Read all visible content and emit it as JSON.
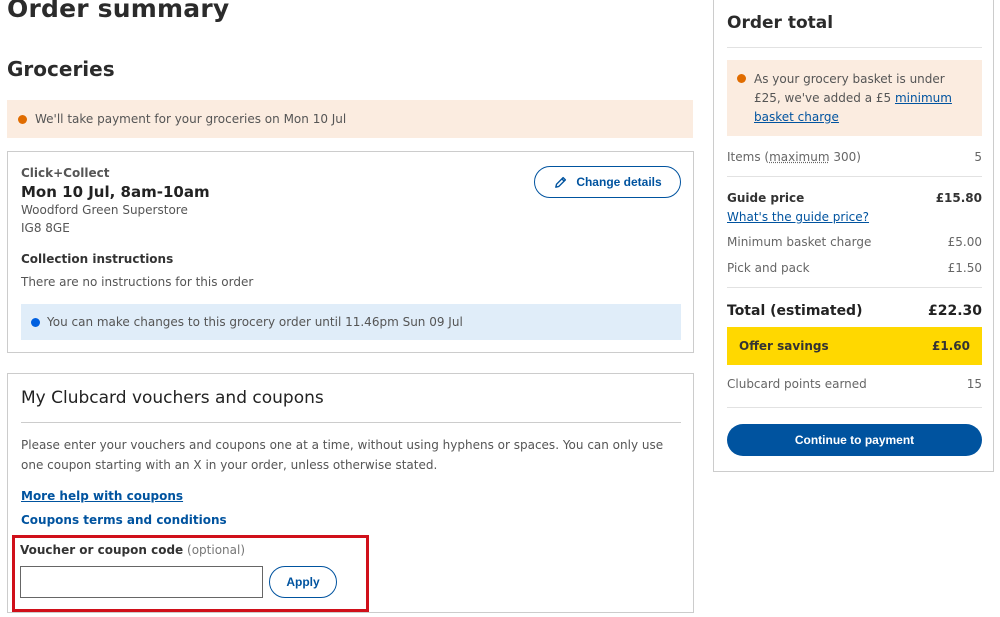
{
  "page": {
    "title": "Order summary",
    "section_title": "Groceries"
  },
  "payment_notice": {
    "icon": "orange-dot-icon",
    "text": "We'll take payment for your groceries on Mon 10 Jul"
  },
  "collection": {
    "type": "Click+Collect",
    "slot": "Mon 10 Jul, 8am-10am",
    "store": "Woodford Green Superstore",
    "postcode": "IG8 8GE",
    "change_button": {
      "icon": "pencil-icon",
      "label": "Change details"
    },
    "instructions_title": "Collection instructions",
    "instructions_text": "There are no instructions for this order",
    "changes_notice": {
      "icon": "blue-dot-icon",
      "text": "You can make changes to this grocery order until 11.46pm Sun 09 Jul"
    }
  },
  "coupons": {
    "heading": "My Clubcard vouchers and coupons",
    "description": "Please enter your vouchers and coupons one at a time, without using hyphens or spaces. You can only use one coupon starting with an X in your order, unless otherwise stated.",
    "help_link": "More help with coupons",
    "terms_link": "Coupons terms and conditions",
    "field_label": "Voucher or coupon code",
    "field_optional": "(optional)",
    "field_value": "",
    "field_placeholder": "",
    "apply_label": "Apply"
  },
  "order_total": {
    "title": "Order total",
    "min_notice": {
      "icon": "orange-dot-icon",
      "text_before": "As your grocery basket is under £25, we've added a £5 ",
      "link": "minimum basket charge"
    },
    "items": {
      "label_prefix": "Items (",
      "label_abbr": "maximum",
      "label_suffix": " 300)",
      "value": "5"
    },
    "guide_price": {
      "label": "Guide price",
      "value": "£15.80",
      "link": "What's the guide price?"
    },
    "min_basket_charge": {
      "label": "Minimum basket charge",
      "value": "£5.00"
    },
    "pick_and_pack": {
      "label": "Pick and pack",
      "value": "£1.50"
    },
    "total": {
      "label": "Total (estimated)",
      "value": "£22.30"
    },
    "savings": {
      "label": "Offer savings",
      "value": "£1.60"
    },
    "clubcard_points": {
      "label": "Clubcard points earned",
      "value": "15"
    },
    "continue_label": "Continue to payment"
  },
  "colors": {
    "brand_blue": "#00539f",
    "notice_orange_bg": "#fbece0",
    "notice_blue_bg": "#e0edf9",
    "savings_yellow": "#ffd800",
    "highlight_red": "#d0101a"
  }
}
